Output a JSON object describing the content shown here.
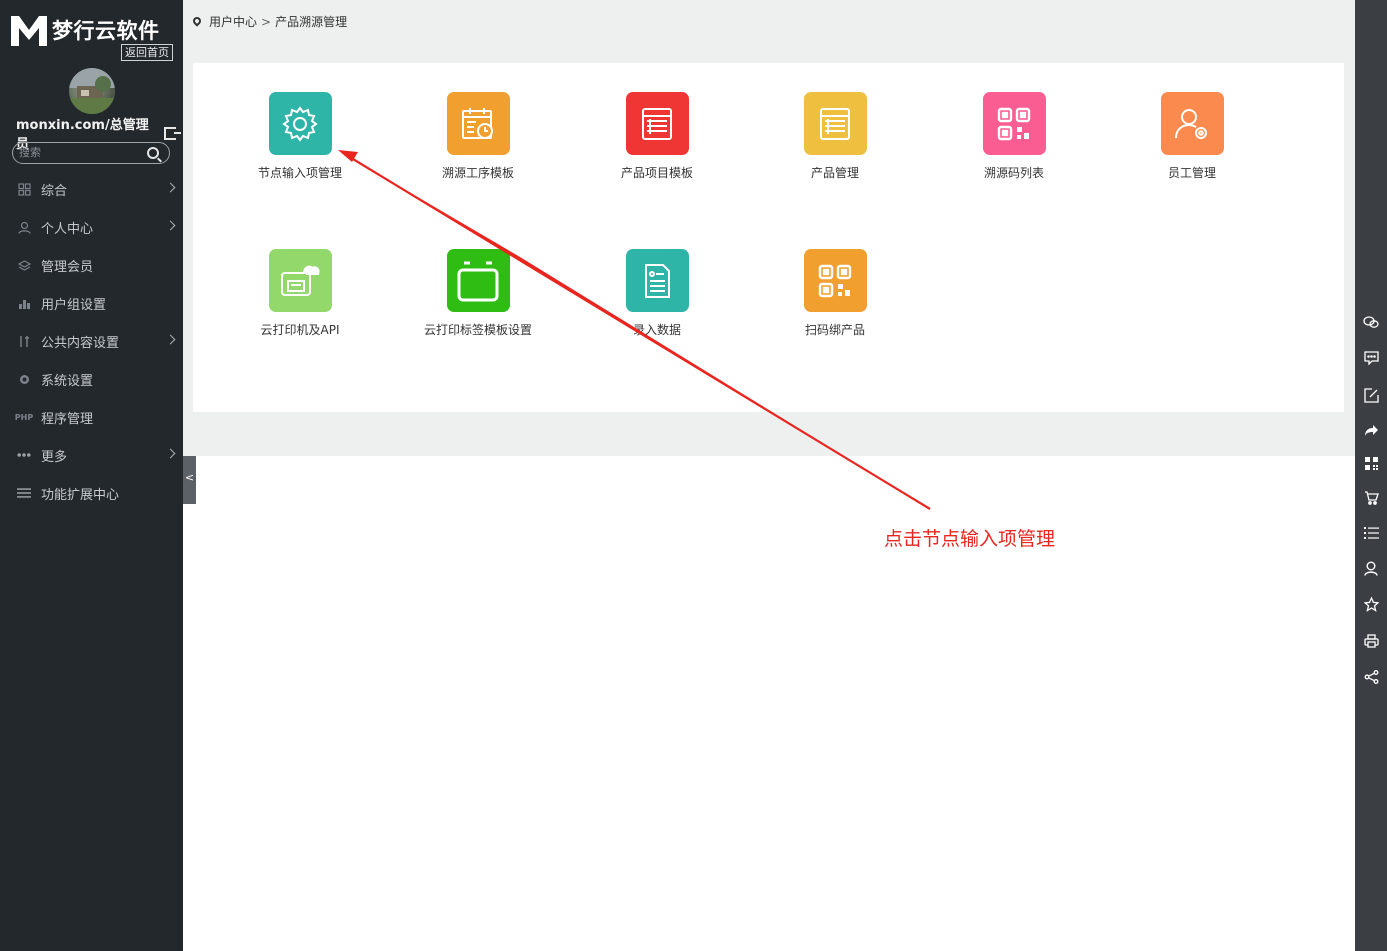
{
  "brand": {
    "name": "梦行云软件",
    "home_link": "返回首页"
  },
  "user": {
    "name": "monxin.com/总管理员"
  },
  "search": {
    "placeholder": "搜索"
  },
  "menu": [
    {
      "label": "综合",
      "icon": "grid-icon",
      "has_children": true
    },
    {
      "label": "个人中心",
      "icon": "user-icon",
      "has_children": true
    },
    {
      "label": "管理会员",
      "icon": "layers-icon",
      "has_children": false
    },
    {
      "label": "用户组设置",
      "icon": "group-icon",
      "has_children": false
    },
    {
      "label": "公共内容设置",
      "icon": "tools-icon",
      "has_children": true
    },
    {
      "label": "系统设置",
      "icon": "gear-icon",
      "has_children": false
    },
    {
      "label": "程序管理",
      "icon": "php-icon",
      "has_children": false
    },
    {
      "label": "更多",
      "icon": "more-icon",
      "has_children": true
    },
    {
      "label": "功能扩展中心",
      "icon": "menu-icon",
      "has_children": false
    }
  ],
  "breadcrumb": {
    "root": "用户中心",
    "sep": ">",
    "current": "产品溯源管理"
  },
  "tiles": [
    {
      "label": "节点输入项管理",
      "icon": "gear-icon",
      "color": "#2fb4a8"
    },
    {
      "label": "溯源工序模板",
      "icon": "calendar-clock-icon",
      "color": "#f1a02f"
    },
    {
      "label": "产品项目模板",
      "icon": "list-icon",
      "color": "#f03535"
    },
    {
      "label": "产品管理",
      "icon": "list-icon",
      "color": "#efc040"
    },
    {
      "label": "溯源码列表",
      "icon": "qrcode-icon",
      "color": "#fa5d92"
    },
    {
      "label": "员工管理",
      "icon": "user-gear-icon",
      "color": "#fb8a4e"
    },
    {
      "label": "云打印机及API",
      "icon": "cloud-printer-icon",
      "color": "#93d86a"
    },
    {
      "label": "云打印标签模板设置",
      "icon": "window-icon",
      "color": "#2fbd14"
    },
    {
      "label": "录入数据",
      "icon": "document-icon",
      "color": "#2fb4a8"
    },
    {
      "label": "扫码绑产品",
      "icon": "qrcode-icon",
      "color": "#f1a02f"
    }
  ],
  "rightbar": [
    "wechat-icon",
    "comment-icon",
    "edit-icon",
    "share-arrow-icon",
    "qrcode-icon",
    "cart-icon",
    "list-icon",
    "user-icon",
    "star-icon",
    "print-icon",
    "share-icon"
  ],
  "annotation": {
    "text": "点击节点输入项管理",
    "color": "#e8261f"
  }
}
